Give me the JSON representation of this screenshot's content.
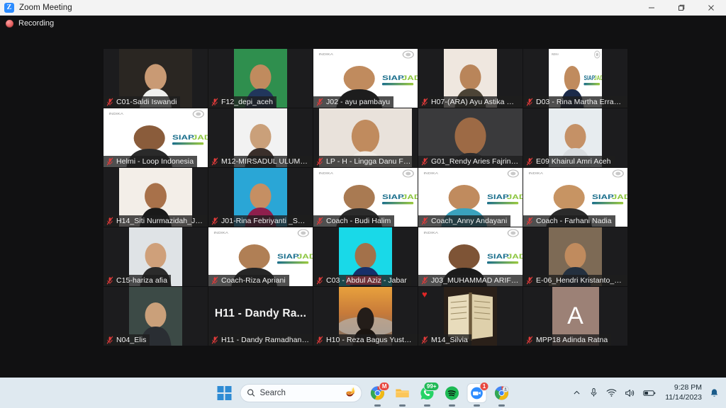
{
  "window": {
    "title": "Zoom Meeting",
    "logo_text": "Z",
    "minimize_label": "Minimize",
    "restore_label": "Restore",
    "close_label": "Close"
  },
  "meeting": {
    "recording_label": "Recording",
    "active_speaker_color": "#b5d334",
    "highlight_color": "#d9b320",
    "tiles": [
      {
        "name": "C01-Saldi Iswandi",
        "muted": true,
        "layout": "mid",
        "kind": "video",
        "bg": "#2a2622",
        "skin": "#c99a74",
        "shirt": "#f0f0ee"
      },
      {
        "name": "F12_depi_aceh",
        "muted": true,
        "layout": "narrow",
        "kind": "video",
        "bg": "#2f8f4e",
        "skin": "#c08b5e",
        "shirt": "#21365c"
      },
      {
        "name": "J02 - ayu pambayu",
        "muted": true,
        "layout": "full",
        "kind": "siap",
        "bg": "#ffffff",
        "skin": "#c08b5e",
        "shirt": "#1d1d1d"
      },
      {
        "name": "H07-(ARA) Ayu Astika Sar...",
        "muted": true,
        "layout": "narrow",
        "kind": "video",
        "bg": "#efe7df",
        "skin": "#b9855a",
        "shirt": "#4c4436"
      },
      {
        "name": "D03 - Rina Martha Erraw...",
        "muted": true,
        "layout": "narrow",
        "kind": "siapsm",
        "bg": "#ffffff",
        "skin": "#c08b5e",
        "shirt": "#1b2a4a"
      },
      {
        "name": "Helmi - Loop Indonesia",
        "muted": true,
        "layout": "full",
        "kind": "siap",
        "bg": "#ffffff",
        "skin": "#8a5c3b",
        "shirt": "#2a2a2a"
      },
      {
        "name": "M12-MIRSADUL ULUM J...",
        "muted": true,
        "layout": "narrow",
        "kind": "video",
        "bg": "#f2f2f2",
        "skin": "#caa07a",
        "shirt": "#3a2f2b"
      },
      {
        "name": "LP - H - Lingga Danu Feb...",
        "muted": true,
        "layout": "wide",
        "kind": "video",
        "bg": "#e9e2db",
        "skin": "#c08b5e",
        "shirt": "#efeae4"
      },
      {
        "name": "G01_Rendy Aries Fajrin_Ja...",
        "muted": true,
        "layout": "full",
        "kind": "video",
        "bg": "#3a3a3c",
        "skin": "#9d6a45",
        "shirt": "#2b2b2d"
      },
      {
        "name": "E09 Khairul Amri Aceh",
        "muted": true,
        "layout": "narrow",
        "kind": "video",
        "bg": "#e7ecef",
        "skin": "#c59166",
        "shirt": "#d9dde0"
      },
      {
        "name": "H14_Siti Nurmazidah_Jab...",
        "muted": true,
        "layout": "mid",
        "kind": "video",
        "bg": "#f3eee8",
        "skin": "#a8714a",
        "shirt": "#191919"
      },
      {
        "name": "J01-Rina Febriyanti _Sum...",
        "muted": true,
        "layout": "narrow",
        "kind": "video",
        "bg": "#2aa6d6",
        "skin": "#c58f63",
        "shirt": "#8e1f4d"
      },
      {
        "name": "Coach - Budi Halim",
        "muted": true,
        "layout": "full",
        "kind": "siap",
        "bg": "#ffffff",
        "skin": "#a97a52",
        "shirt": "#2b2b2b"
      },
      {
        "name": "Coach_Anny Andayani",
        "muted": true,
        "layout": "full",
        "kind": "siap",
        "bg": "#ffffff",
        "skin": "#c08b5e",
        "shirt": "#3aa2bd",
        "active": true
      },
      {
        "name": "Coach - Farhani Nadia",
        "muted": true,
        "layout": "full",
        "kind": "siap",
        "bg": "#ffffff",
        "skin": "#c79463",
        "shirt": "#2b2b2b",
        "active2": true
      },
      {
        "name": "C15-hariza afia",
        "muted": true,
        "layout": "narrow",
        "kind": "video",
        "bg": "#dfe3e6",
        "skin": "#cfa07a",
        "shirt": "#2b2b2b"
      },
      {
        "name": "Coach-Riza Apriani",
        "muted": true,
        "layout": "full",
        "kind": "siap",
        "bg": "#ffffff",
        "skin": "#b07f55",
        "shirt": "#262626"
      },
      {
        "name": "C03 - Abdul Aziz - Jabar",
        "muted": true,
        "layout": "narrow",
        "kind": "video",
        "bg": "#19d9e8",
        "skin": "#a3714a",
        "shirt": "#17306a",
        "name_parts": [
          {
            "t": "C03 - ",
            "hl": "none"
          },
          {
            "t": "Abdul Aziz",
            "hl": "red"
          },
          {
            "t": " - ",
            "hl": "none"
          },
          {
            "t": "Jabar",
            "hl": "none"
          }
        ]
      },
      {
        "name": "J03_MUHAMMAD ARIFIN...",
        "muted": true,
        "layout": "full",
        "kind": "siap",
        "bg": "#ffffff",
        "skin": "#7e5436",
        "shirt": "#1b1b1b"
      },
      {
        "name": "E-06_Hendri Kristanto_Sa...",
        "muted": true,
        "layout": "narrow",
        "kind": "video",
        "bg": "#7d6a55",
        "skin": "#c08b5e",
        "shirt": "#24303f"
      },
      {
        "name": "N04_Elis",
        "muted": true,
        "layout": "narrow",
        "kind": "video",
        "bg": "#3c4a46",
        "skin": "#caa07a",
        "shirt": "#2a2e33"
      },
      {
        "name": "H11 - Dandy Ramadhany ...",
        "muted": true,
        "layout": "full",
        "kind": "bigtext",
        "big_text": "H11 - Dandy Ra..."
      },
      {
        "name": "H10 - Reza Bagus Yustria...",
        "muted": true,
        "layout": "narrow",
        "kind": "sunset",
        "bg": "#c98a3d",
        "skin": "#2a2320",
        "shirt": "#1b1714"
      },
      {
        "name": "M14_Silvia",
        "muted": true,
        "layout": "narrow",
        "kind": "book",
        "bg": "#241b14",
        "reaction": "♥"
      },
      {
        "name": "MPP18 Adinda Ratna",
        "muted": true,
        "layout": "narrow",
        "kind": "avatar",
        "initial": "A",
        "avatar_color": "#9c8176"
      }
    ]
  },
  "taskbar": {
    "start_label": "Start",
    "search_placeholder": "Search",
    "search_icon": "search-icon",
    "apps": [
      {
        "name": "chrome-gmail",
        "badge": "M",
        "badge_color": "#e8483f"
      },
      {
        "name": "file-explorer",
        "badge": "",
        "badge_color": ""
      },
      {
        "name": "whatsapp",
        "badge": "99+",
        "badge_color": "#1fb955"
      },
      {
        "name": "spotify",
        "badge": "",
        "badge_color": ""
      },
      {
        "name": "zoom",
        "badge": "1",
        "badge_color": "#e8483f"
      },
      {
        "name": "chrome-profile",
        "badge": "",
        "badge_color": ""
      }
    ],
    "tray": {
      "overflow_icon": "chevron-up-icon",
      "mic_icon": "microphone-icon",
      "wifi_icon": "wifi-icon",
      "volume_icon": "speaker-icon",
      "battery_icon": "battery-icon",
      "time": "9:28 PM",
      "date": "11/14/2023",
      "notification_icon": "bell-icon"
    }
  }
}
